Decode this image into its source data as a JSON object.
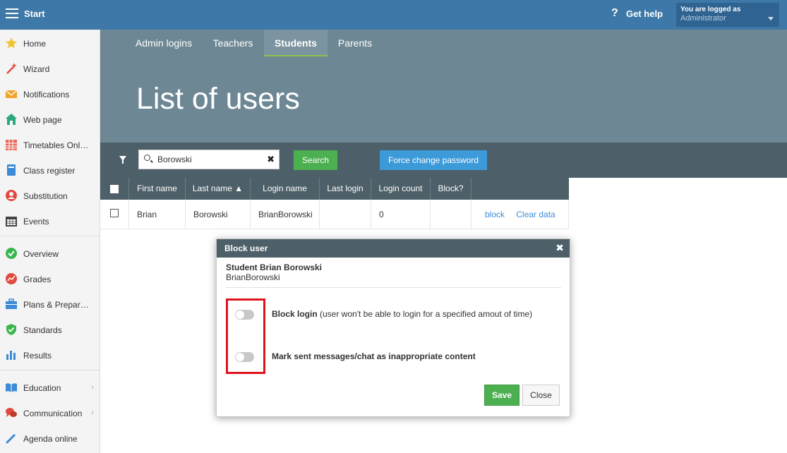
{
  "topbar": {
    "start_label": "Start",
    "help_label": "Get help",
    "logged_line1": "You are logged as",
    "logged_user": "Administrator"
  },
  "sidebar": {
    "items": [
      {
        "label": "Home",
        "icon": "star-icon"
      },
      {
        "label": "Wizard",
        "icon": "magic-wand-icon"
      },
      {
        "label": "Notifications",
        "icon": "envelope-icon"
      },
      {
        "label": "Web page",
        "icon": "house-icon"
      },
      {
        "label": "Timetables Onl…",
        "icon": "calendar-grid-icon"
      },
      {
        "label": "Class register",
        "icon": "book-icon"
      },
      {
        "label": "Substitution",
        "icon": "person-icon"
      },
      {
        "label": "Events",
        "icon": "calendar-icon"
      },
      {
        "label": "Overview",
        "icon": "check-circle-icon"
      },
      {
        "label": "Grades",
        "icon": "chart-circle-icon"
      },
      {
        "label": "Plans & Prepar…",
        "icon": "briefcase-icon"
      },
      {
        "label": "Standards",
        "icon": "shield-check-icon"
      },
      {
        "label": "Results",
        "icon": "bar-chart-icon"
      },
      {
        "label": "Education",
        "icon": "open-book-icon"
      },
      {
        "label": "Communication",
        "icon": "chat-bubbles-icon"
      },
      {
        "label": "Agenda online",
        "icon": "pencil-icon"
      }
    ],
    "chevron": "›"
  },
  "tabs": [
    {
      "label": "Admin logins"
    },
    {
      "label": "Teachers"
    },
    {
      "label": "Students"
    },
    {
      "label": "Parents"
    }
  ],
  "page_title": "List of users",
  "search": {
    "value": "Borowski",
    "clear_glyph": "✖",
    "search_label": "Search",
    "force_label": "Force change password"
  },
  "table": {
    "columns": [
      "First name",
      "Last name ▲",
      "Login name",
      "Last login",
      "Login count",
      "Block?"
    ],
    "rows": [
      {
        "first": "Brian",
        "last": "Borowski",
        "login": "BrianBorowski",
        "last_login": "",
        "count": "0",
        "blocked": "",
        "action1": "block",
        "action2": "Clear data"
      }
    ]
  },
  "modal": {
    "title": "Block user",
    "close_glyph": "✖",
    "user_name": "Student Brian Borowski",
    "user_login": "BrianBorowski",
    "option1_bold": "Block login",
    "option1_rest": " (user won't be able to login for a specified amout of time)",
    "option2_bold": "Mark sent messages/chat as inappropriate content",
    "save_label": "Save",
    "close_label": "Close"
  },
  "colors": {
    "topbar": "#3d78a8",
    "hero": "#6d8794",
    "toolbar": "#4d5f68",
    "accent_green": "#4caf50",
    "accent_blue": "#3d9ad9",
    "highlight_red": "#e0141e"
  }
}
